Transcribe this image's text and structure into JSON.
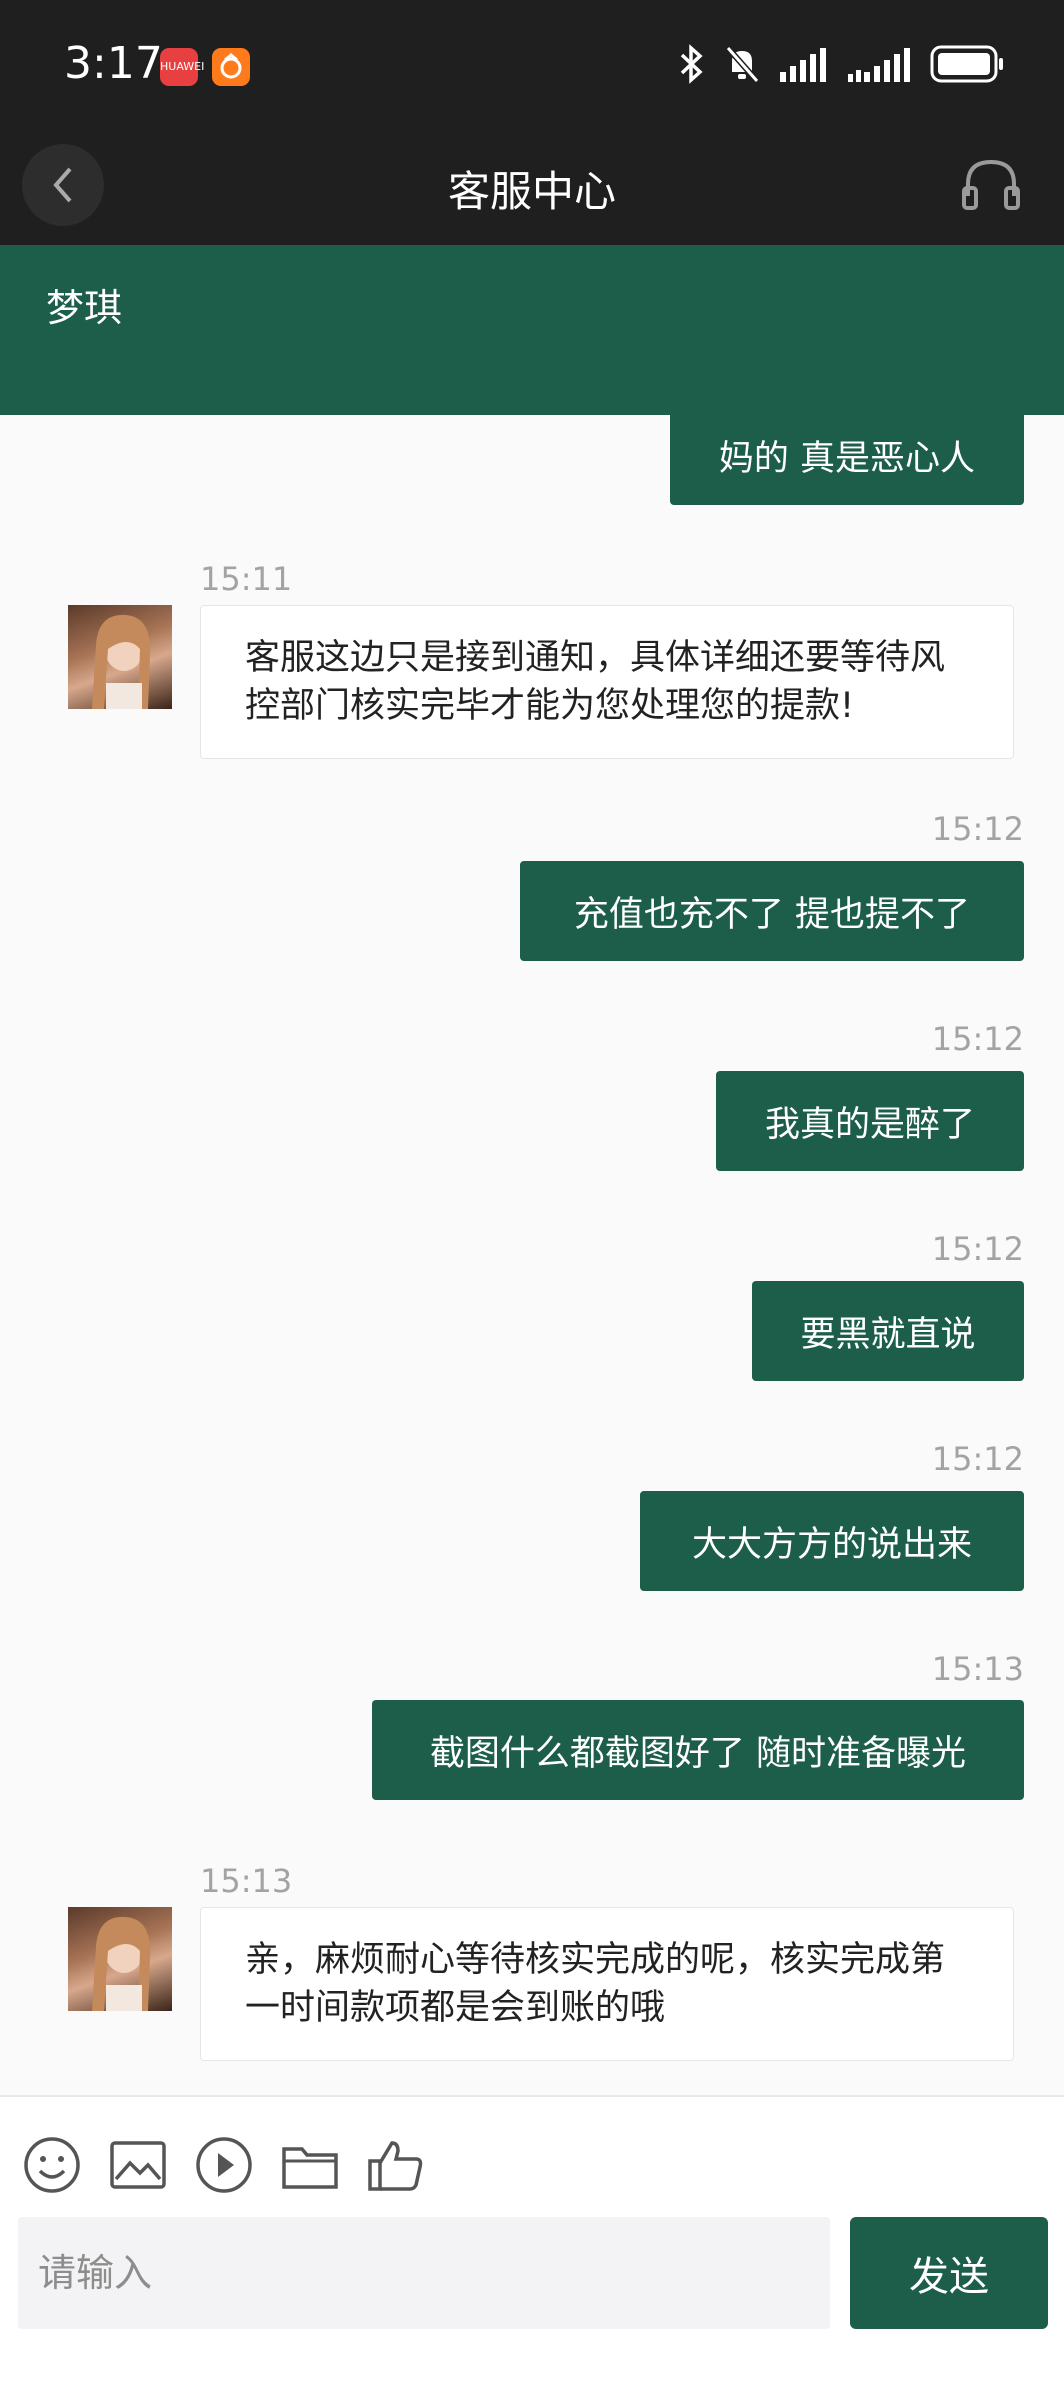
{
  "status": {
    "time": "3:17",
    "app1_label": "HUAWEI",
    "icons": [
      "bluetooth-icon",
      "mute-bell-icon",
      "signal-icon",
      "signal-icon-2",
      "battery-icon"
    ]
  },
  "header": {
    "title": "客服中心"
  },
  "agent": {
    "name": "梦琪"
  },
  "messages": [
    {
      "side": "out",
      "text": "妈的 真是恶心人"
    },
    {
      "side": "in",
      "time": "15:11",
      "text": "客服这边只是接到通知，具体详细还要等待风控部门核实完毕才能为您处理您的提款!"
    },
    {
      "side": "out",
      "time": "15:12",
      "text": "充值也充不了 提也提不了"
    },
    {
      "side": "out",
      "time": "15:12",
      "text": "我真的是醉了"
    },
    {
      "side": "out",
      "time": "15:12",
      "text": "要黑就直说"
    },
    {
      "side": "out",
      "time": "15:12",
      "text": "大大方方的说出来"
    },
    {
      "side": "out",
      "time": "15:13",
      "text": "截图什么都截图好了 随时准备曝光"
    },
    {
      "side": "in",
      "time": "15:13",
      "text": "亲，麻烦耐心等待核实完成的呢，核实完成第一时间款项都是会到账的哦"
    }
  ],
  "input": {
    "placeholder": "请输入",
    "send_label": "发送"
  },
  "colors": {
    "brand": "#1c5e4a",
    "header_bg": "#1f1f1f"
  }
}
